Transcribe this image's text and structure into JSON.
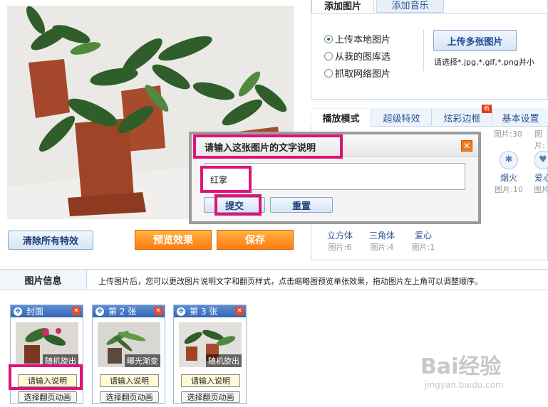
{
  "preview": {
    "clear_label": "清除所有特效",
    "preview_label": "预览效果",
    "save_label": "保存"
  },
  "upload_panel": {
    "tabs": [
      "添加图片",
      "添加音乐"
    ],
    "options": [
      "上传本地图片",
      "从我的图库选",
      "抓取网络图片"
    ],
    "upload_button": "上传多张图片",
    "hint": "请选择*.jpg,*.gif,*.png并小"
  },
  "effects_panel": {
    "tabs": [
      "播放模式",
      "超级特效",
      "炫彩边框",
      "基本设置"
    ],
    "new_badge": "新",
    "top_counts": [
      "图片:30",
      "图片:"
    ],
    "row1": [
      {
        "name": "烟火",
        "count": "图片:10"
      },
      {
        "name": "爱心",
        "count": "图片:"
      }
    ],
    "row2": [
      {
        "name": "立方体",
        "count": "图片:6"
      },
      {
        "name": "三角体",
        "count": "图片:4"
      },
      {
        "name": "爱心",
        "count": "图片:1"
      }
    ]
  },
  "dialog": {
    "title": "请输入这张图片的文字说明",
    "close": "✕",
    "input_value": "红掌",
    "submit": "提交",
    "reset": "重置"
  },
  "info": {
    "label": "图片信息",
    "text": "上传图片后，您可以更改图片说明文字和翻页样式，点击缩略图预览单张效果，拖动图片左上角可以调整顺序。"
  },
  "cards": [
    {
      "title": "封面",
      "effect": "随机旋出",
      "desc_btn": "请输入说明",
      "anim_btn": "选择翻页动画"
    },
    {
      "title": "第 2 张",
      "effect": "曝光渐变",
      "desc_btn": "请输入说明",
      "anim_btn": "选择翻页动画"
    },
    {
      "title": "第 3 张",
      "effect": "随机旋出",
      "desc_btn": "请输入说明",
      "anim_btn": "选择翻页动画"
    }
  ],
  "watermark": {
    "logo": "Bai经验",
    "url": "jingyan.baidu.com"
  },
  "colors": {
    "highlight": "#e0137a",
    "accent_orange": "#ff7b0d",
    "link_blue": "#2b5493"
  }
}
